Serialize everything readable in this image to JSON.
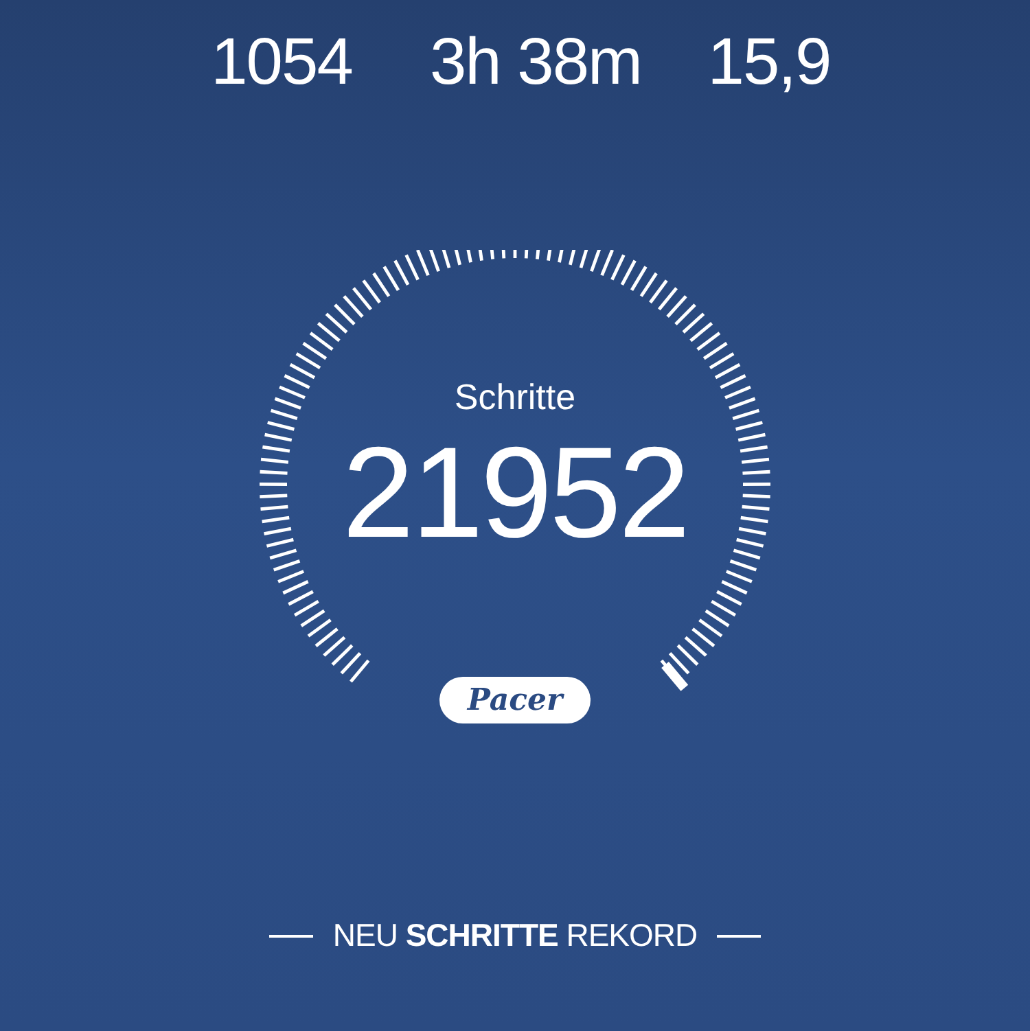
{
  "stats": [
    {
      "value": "1054"
    },
    {
      "value": "3h 38m"
    },
    {
      "value": "15,9"
    }
  ],
  "gauge": {
    "label": "Schritte",
    "value": "21952",
    "logo": "Pacer"
  },
  "record": {
    "text": "NEU **SCHRITTE** REKORD"
  }
}
